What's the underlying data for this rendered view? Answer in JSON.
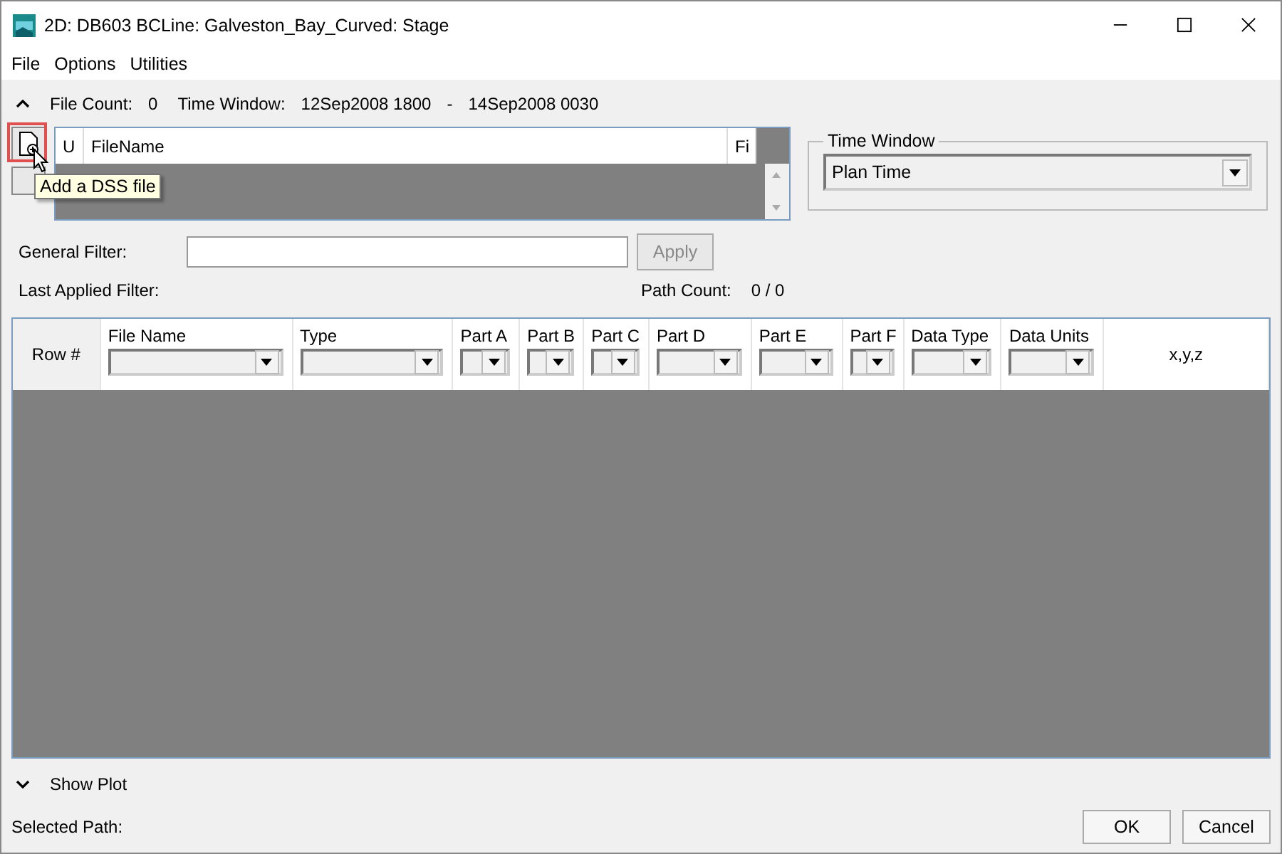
{
  "window": {
    "title": "2D: DB603 BCLine: Galveston_Bay_Curved: Stage"
  },
  "menu": [
    "File",
    "Options",
    "Utilities"
  ],
  "summary": {
    "expanded": true,
    "file_count_label": "File Count:",
    "file_count": "0",
    "time_window_label": "Time Window:",
    "start": "12Sep2008 1800",
    "separator": "-",
    "end": "14Sep2008 0030"
  },
  "file_table": {
    "columns": [
      "U",
      "FileName",
      "Fi"
    ],
    "tooltip": "Add a DSS file"
  },
  "time_window": {
    "legend": "Time Window",
    "value": "Plan Time"
  },
  "filter": {
    "label": "General Filter:",
    "apply": {
      "label": "Apply",
      "disabled": true
    },
    "last_applied_label": "Last Applied Filter:",
    "path_count_label": "Path Count:",
    "path_count": "0 / 0"
  },
  "grid": {
    "columns": [
      {
        "label": "Row #",
        "kind": "plain"
      },
      {
        "label": "File Name",
        "kind": "dropdown"
      },
      {
        "label": "Type",
        "kind": "dropdown"
      },
      {
        "label": "Part A",
        "kind": "dropdown"
      },
      {
        "label": "Part B",
        "kind": "dropdown"
      },
      {
        "label": "Part C",
        "kind": "dropdown"
      },
      {
        "label": "Part D",
        "kind": "dropdown"
      },
      {
        "label": "Part E",
        "kind": "dropdown"
      },
      {
        "label": "Part F",
        "kind": "dropdown"
      },
      {
        "label": "Data Type",
        "kind": "dropdown"
      },
      {
        "label": "Data Units",
        "kind": "dropdown"
      },
      {
        "label": "x,y,z",
        "kind": "plain"
      }
    ]
  },
  "show_plot": {
    "label": "Show Plot",
    "expanded": false
  },
  "selected_path_label": "Selected Path:",
  "buttons": [
    "OK",
    "Cancel"
  ]
}
